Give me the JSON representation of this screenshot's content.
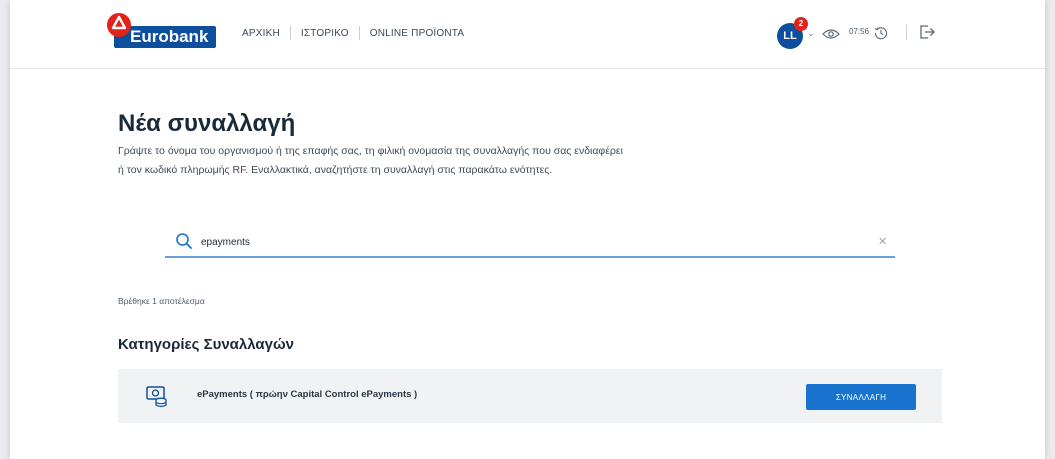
{
  "header": {
    "logo_text": "Eurobank",
    "nav": [
      "ΑΡΧΙΚΗ",
      "ΙΣΤΟΡΙΚΟ",
      "ONLINE ΠΡΟΪΟΝΤΑ"
    ],
    "avatar_initials": "LL",
    "notification_count": "2",
    "session_time": "07:56"
  },
  "main": {
    "title": "Νέα συναλλαγή",
    "description": "Γράψτε το όνομα του οργανισμού ή της επαφής σας, τη φιλική ονομασία της συναλλαγής που σας ενδιαφέρει ή τον κωδικό πληρωμής RF. Εναλλακτικά, αναζητήστε τη συναλλαγή στις παρακάτω ενότητες.",
    "search": {
      "value": "epayments"
    },
    "results_text": "Βρέθηκε 1 αποτέλεσμα",
    "categories_title": "Κατηγορίες Συναλλαγών",
    "category_row": {
      "label": "ePayments ( πρώην Capital Control ePayments )",
      "button_label": "ΣΥΝΑΛΛΑΓΗ"
    }
  },
  "colors": {
    "brand_blue": "#0d4f9c",
    "brand_red": "#e2231a",
    "action_blue": "#1874cf",
    "search_underline": "#6a9fd8"
  },
  "icons": [
    "eurobank-logo-icon",
    "chevron-down-icon",
    "eye-icon",
    "clock-icon",
    "logout-icon",
    "search-icon",
    "close-icon",
    "epayments-icon"
  ]
}
